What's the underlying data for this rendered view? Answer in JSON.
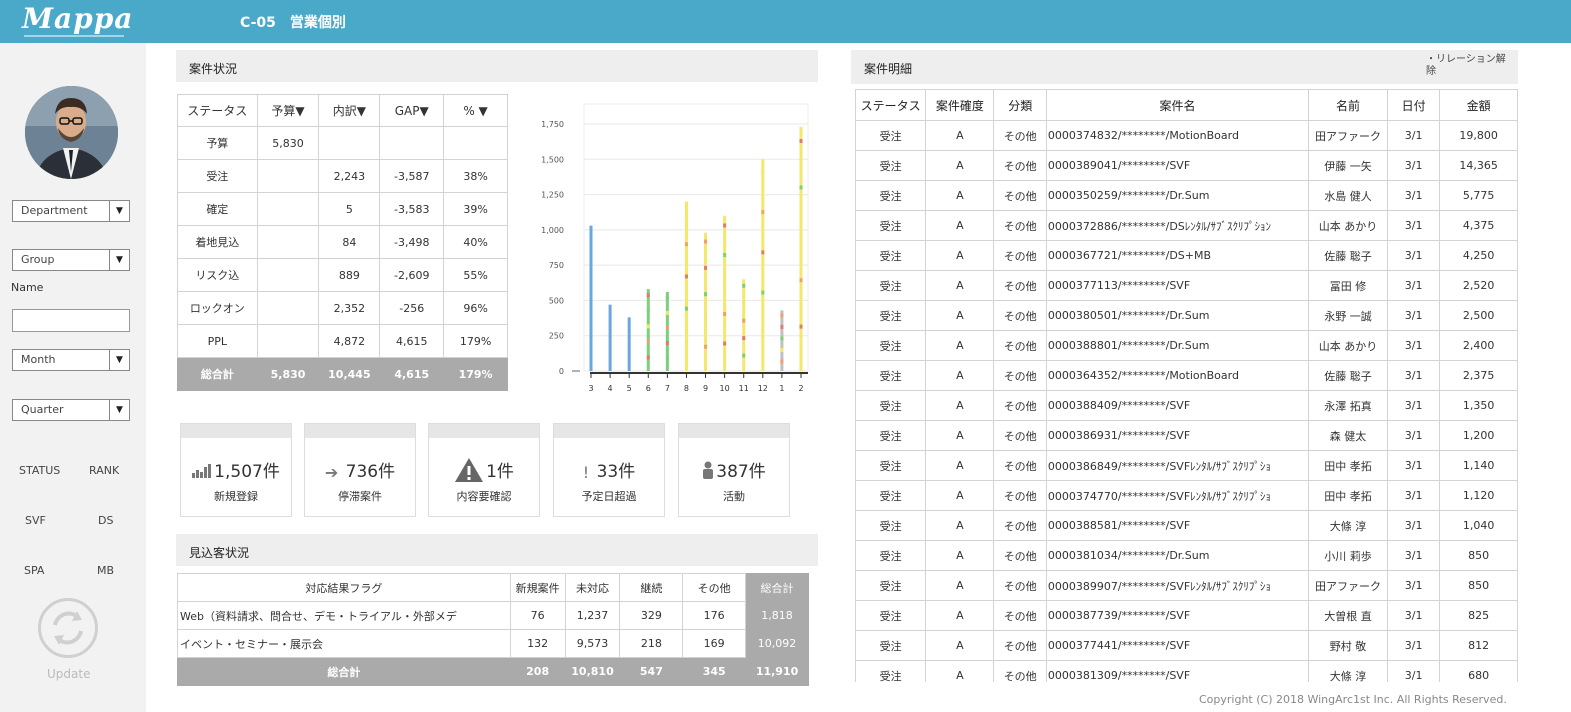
{
  "app": {
    "logo": "Mappa",
    "page_title": "C-05　営業個別"
  },
  "sidebar": {
    "department": "Department",
    "group": "Group",
    "name_label": "Name",
    "month": "Month",
    "quarter": "Quarter",
    "links": [
      "STATUS",
      "RANK",
      "SVF",
      "DS",
      "SPA",
      "MB"
    ],
    "update_label": "Update",
    "dropdown_glyph": "▼"
  },
  "status_section": {
    "title": "案件状況",
    "headers": [
      "ステータス",
      "予算▼",
      "内訳▼",
      "GAP▼",
      "%  ▼"
    ],
    "rows": [
      [
        "予算",
        "5,830",
        "",
        "",
        ""
      ],
      [
        "受注",
        "",
        "2,243",
        "-3,587",
        "38%"
      ],
      [
        "確定",
        "",
        "5",
        "-3,583",
        "39%"
      ],
      [
        "着地見込",
        "",
        "84",
        "-3,498",
        "40%"
      ],
      [
        "リスク込",
        "",
        "889",
        "-2,609",
        "55%"
      ],
      [
        "ロックオン",
        "",
        "2,352",
        "-256",
        "96%"
      ],
      [
        "PPL",
        "",
        "4,872",
        "4,615",
        "179%"
      ]
    ],
    "total": [
      "総合計",
      "5,830",
      "10,445",
      "4,615",
      "179%"
    ]
  },
  "chart_data": {
    "type": "bar",
    "categories": [
      "3",
      "4",
      "5",
      "6",
      "7",
      "8",
      "9",
      "10",
      "11",
      "12",
      "1",
      "2"
    ],
    "yticks": [
      "0",
      "250",
      "500",
      "750",
      "1,000",
      "1,250",
      "1,500",
      "1,750"
    ],
    "ylim": [
      0,
      1750
    ],
    "colors": {
      "blue": "#6aa6e0",
      "green": "#7ccf7c",
      "yellow": "#f3e86a",
      "orange": "#f0a070",
      "red": "#e07a6a",
      "grey": "#c0c0c0"
    },
    "series": [
      {
        "values": [
          1030,
          470,
          380,
          580,
          560,
          1200,
          980,
          1100,
          650,
          1500,
          430,
          1730
        ]
      }
    ]
  },
  "kpis": [
    {
      "icon": "bar-chart-icon",
      "glyph": "▮",
      "value": "1,507件",
      "label": "新規登録"
    },
    {
      "icon": "arrow-right-icon",
      "glyph": "➔",
      "value": "736件",
      "label": "停滞案件"
    },
    {
      "icon": "warning-icon",
      "glyph": "▲",
      "value": "1件",
      "label": "内容要確認"
    },
    {
      "icon": "exclamation-icon",
      "glyph": "!",
      "value": "33件",
      "label": "予定日超過"
    },
    {
      "icon": "person-icon",
      "glyph": "♟",
      "value": "387件",
      "label": "活動"
    }
  ],
  "prospect_section": {
    "title": "見込客状況",
    "headers": [
      "対応結果フラグ",
      "新規案件",
      "未対応",
      "継続",
      "その他",
      "総合計"
    ],
    "rows": [
      [
        "Web（資料請求、問合せ、デモ・トライアル・外部メデ",
        "76",
        "1,237",
        "329",
        "176",
        "1,818"
      ],
      [
        "イベント・セミナー・展示会",
        "132",
        "9,573",
        "218",
        "169",
        "10,092"
      ]
    ],
    "total": [
      "総合計",
      "208",
      "10,810",
      "547",
      "345",
      "11,910"
    ]
  },
  "detail_section": {
    "title": "案件明細",
    "relation_link": "・リレーション解除",
    "headers": [
      "ステータス",
      "案件確度",
      "分類",
      "案件名",
      "名前",
      "日付",
      "金額"
    ],
    "rows": [
      [
        "受注",
        "A",
        "その他",
        "0000374832/********/MotionBoard",
        "田アファーク",
        "3/1",
        "19,800"
      ],
      [
        "受注",
        "A",
        "その他",
        "0000389041/********/SVF",
        "伊藤 一矢",
        "3/1",
        "14,365"
      ],
      [
        "受注",
        "A",
        "その他",
        "0000350259/********/Dr.Sum",
        "水島 健人",
        "3/1",
        "5,775"
      ],
      [
        "受注",
        "A",
        "その他",
        "0000372886/********/DSﾚﾝﾀﾙ/ｻﾌﾞｽｸﾘﾌﾟｼｮﾝ",
        "山本 あかり",
        "3/1",
        "4,375"
      ],
      [
        "受注",
        "A",
        "その他",
        "0000367721/********/DS+MB",
        "佐藤 聡子",
        "3/1",
        "4,250"
      ],
      [
        "受注",
        "A",
        "その他",
        "0000377113/********/SVF",
        "冨田 修",
        "3/1",
        "2,520"
      ],
      [
        "受注",
        "A",
        "その他",
        "0000380501/********/Dr.Sum",
        "永野 一誠",
        "3/1",
        "2,500"
      ],
      [
        "受注",
        "A",
        "その他",
        "0000388801/********/Dr.Sum",
        "山本 あかり",
        "3/1",
        "2,400"
      ],
      [
        "受注",
        "A",
        "その他",
        "0000364352/********/MotionBoard",
        "佐藤 聡子",
        "3/1",
        "2,375"
      ],
      [
        "受注",
        "A",
        "その他",
        "0000388409/********/SVF",
        "永澤 拓真",
        "3/1",
        "1,350"
      ],
      [
        "受注",
        "A",
        "その他",
        "0000386931/********/SVF",
        "森 健太",
        "3/1",
        "1,200"
      ],
      [
        "受注",
        "A",
        "その他",
        "0000386849/********/SVFﾚﾝﾀﾙ/ｻﾌﾞｽｸﾘﾌﾟｼｮ",
        "田中 孝拓",
        "3/1",
        "1,140"
      ],
      [
        "受注",
        "A",
        "その他",
        "0000374770/********/SVFﾚﾝﾀﾙ/ｻﾌﾞｽｸﾘﾌﾟｼｮ",
        "田中 孝拓",
        "3/1",
        "1,120"
      ],
      [
        "受注",
        "A",
        "その他",
        "0000388581/********/SVF",
        "大條 淳",
        "3/1",
        "1,040"
      ],
      [
        "受注",
        "A",
        "その他",
        "0000381034/********/Dr.Sum",
        "小川 莉歩",
        "3/1",
        "850"
      ],
      [
        "受注",
        "A",
        "その他",
        "0000389907/********/SVFﾚﾝﾀﾙ/ｻﾌﾞｽｸﾘﾌﾟｼｮ",
        "田アファーク",
        "3/1",
        "850"
      ],
      [
        "受注",
        "A",
        "その他",
        "0000387739/********/SVF",
        "大曽根 直",
        "3/1",
        "825"
      ],
      [
        "受注",
        "A",
        "その他",
        "0000377441/********/SVF",
        "野村 敬",
        "3/1",
        "812"
      ],
      [
        "受注",
        "A",
        "その他",
        "0000381309/********/SVF",
        "大條 淳",
        "3/1",
        "680"
      ]
    ]
  },
  "footer": {
    "copyright": "Copyright (C)  2018 WingArc1st Inc. All Rights Reserved."
  }
}
